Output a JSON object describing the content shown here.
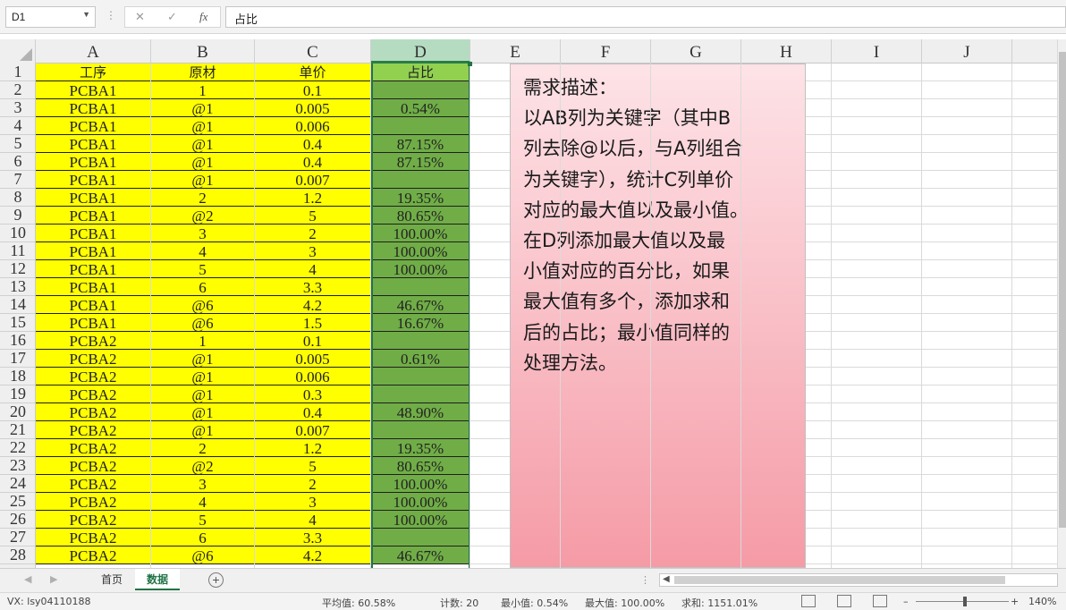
{
  "formula_bar": {
    "name_box": "D1",
    "formula": "占比",
    "cancel_symbol": "✕",
    "confirm_symbol": "✓",
    "function_symbol": "fx"
  },
  "columns": [
    "A",
    "B",
    "C",
    "D",
    "E",
    "F",
    "G",
    "H",
    "I",
    "J"
  ],
  "selected_column": "D",
  "rows": [
    [
      "工序",
      "原材",
      "单价",
      "占比"
    ],
    [
      "PCBA1",
      "1",
      "0.1",
      ""
    ],
    [
      "PCBA1",
      "@1",
      "0.005",
      "0.54%"
    ],
    [
      "PCBA1",
      "@1",
      "0.006",
      ""
    ],
    [
      "PCBA1",
      "@1",
      "0.4",
      "87.15%"
    ],
    [
      "PCBA1",
      "@1",
      "0.4",
      "87.15%"
    ],
    [
      "PCBA1",
      "@1",
      "0.007",
      ""
    ],
    [
      "PCBA1",
      "2",
      "1.2",
      "19.35%"
    ],
    [
      "PCBA1",
      "@2",
      "5",
      "80.65%"
    ],
    [
      "PCBA1",
      "3",
      "2",
      "100.00%"
    ],
    [
      "PCBA1",
      "4",
      "3",
      "100.00%"
    ],
    [
      "PCBA1",
      "5",
      "4",
      "100.00%"
    ],
    [
      "PCBA1",
      "6",
      "3.3",
      ""
    ],
    [
      "PCBA1",
      "@6",
      "4.2",
      "46.67%"
    ],
    [
      "PCBA1",
      "@6",
      "1.5",
      "16.67%"
    ],
    [
      "PCBA2",
      "1",
      "0.1",
      ""
    ],
    [
      "PCBA2",
      "@1",
      "0.005",
      "0.61%"
    ],
    [
      "PCBA2",
      "@1",
      "0.006",
      ""
    ],
    [
      "PCBA2",
      "@1",
      "0.3",
      ""
    ],
    [
      "PCBA2",
      "@1",
      "0.4",
      "48.90%"
    ],
    [
      "PCBA2",
      "@1",
      "0.007",
      ""
    ],
    [
      "PCBA2",
      "2",
      "1.2",
      "19.35%"
    ],
    [
      "PCBA2",
      "@2",
      "5",
      "80.65%"
    ],
    [
      "PCBA2",
      "3",
      "2",
      "100.00%"
    ],
    [
      "PCBA2",
      "4",
      "3",
      "100.00%"
    ],
    [
      "PCBA2",
      "5",
      "4",
      "100.00%"
    ],
    [
      "PCBA2",
      "6",
      "3.3",
      ""
    ],
    [
      "PCBA2",
      "@6",
      "4.2",
      "46.67%"
    ]
  ],
  "note_lines": [
    "需求描述：",
    "以AB列为关键字（其中B",
    "列去除@以后，与A列组合",
    "为关键字），统计C列单价",
    "对应的最大值以及最小值。",
    "在D列添加最大值以及最",
    "小值对应的百分比，如果",
    "最大值有多个，添加求和",
    "后的占比；最小值同样的",
    "处理方法。"
  ],
  "sheet_tabs": [
    "首页",
    "数据"
  ],
  "active_tab": "数据",
  "add_sheet_symbol": "+",
  "status": {
    "left": "VX:  lsy04110188",
    "average": "平均值: 60.58%",
    "count": "计数: 20",
    "min": "最小值: 0.54%",
    "max": "最大值: 100.00%",
    "sum": "求和: 1151.01%",
    "zoom_minus": "–",
    "zoom_plus": "+",
    "zoom": "140%"
  },
  "colors": {
    "data_fill": "#ffff00",
    "ratio_fill": "#70ad47",
    "ratio_header_fill": "#92d050",
    "selection": "#217346"
  }
}
